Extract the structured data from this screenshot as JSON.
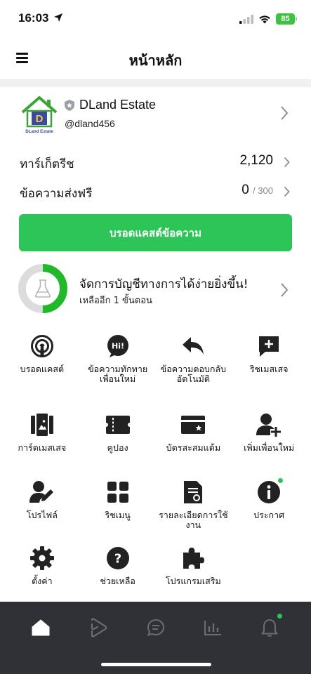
{
  "status_bar": {
    "time": "16:03",
    "battery": "85"
  },
  "header": {
    "title": "หน้าหลัก",
    "menu_icon": "hamburger-menu-icon"
  },
  "profile": {
    "name": "DLand Estate",
    "id": "@dland456",
    "logo_text": "DLand Estate",
    "logo_letter": "D"
  },
  "stats": {
    "target_label": "ทาร์เก็ตรีช",
    "target_value": "2,120",
    "free_msg_label": "ข้อความส่งฟรี",
    "free_msg_value": "0",
    "free_msg_total": "/ 300"
  },
  "broadcast_button": "บรอดแคสต์ข้อความ",
  "setup": {
    "title": "จัดการบัญชีทางการได้ง่ายยิ่งขึ้น!",
    "subtitle": "เหลืออีก 1 ขั้นตอน",
    "progress": 0.5
  },
  "grid": [
    {
      "label": "บรอดแคสต์",
      "icon": "broadcast-icon"
    },
    {
      "label": "ข้อความทักทายเพื่อนใหม่",
      "icon": "greeting-message-icon"
    },
    {
      "label": "ข้อความตอบกลับอัตโนมัติ",
      "icon": "auto-reply-icon"
    },
    {
      "label": "ริชเมสเสจ",
      "icon": "rich-message-icon"
    },
    {
      "label": "การ์ดเมสเสจ",
      "icon": "card-message-icon"
    },
    {
      "label": "คูปอง",
      "icon": "coupon-icon"
    },
    {
      "label": "บัตรสะสมแต้ม",
      "icon": "reward-card-icon"
    },
    {
      "label": "เพิ่มเพื่อนใหม่",
      "icon": "add-friend-icon"
    },
    {
      "label": "โปรไฟล์",
      "icon": "profile-edit-icon"
    },
    {
      "label": "ริชเมนู",
      "icon": "rich-menu-icon"
    },
    {
      "label": "รายละเอียดการใช้งาน",
      "icon": "usage-details-icon"
    },
    {
      "label": "ประกาศ",
      "icon": "announcement-icon"
    },
    {
      "label": "ตั้งค่า",
      "icon": "settings-gear-icon"
    },
    {
      "label": "ช่วยเหลือ",
      "icon": "help-icon"
    },
    {
      "label": "โปรแกรมเสริม",
      "icon": "extension-puzzle-icon"
    }
  ],
  "bottom_nav": [
    "home-icon",
    "video-play-icon",
    "chat-icon",
    "insight-chart-icon",
    "notification-bell-icon"
  ],
  "colors": {
    "accent": "#2dc558",
    "nav_bg": "#2f3137"
  }
}
